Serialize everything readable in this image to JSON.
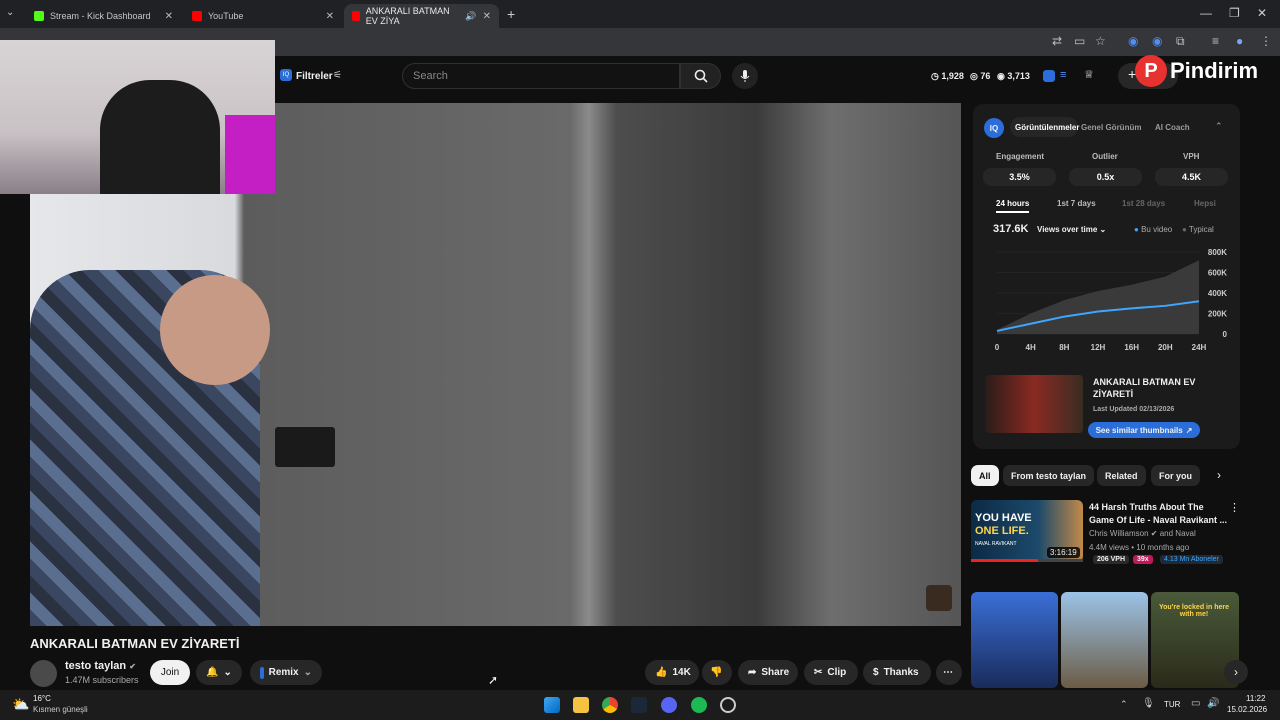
{
  "tabs": [
    {
      "label": "Stream - Kick Dashboard",
      "favicon_color": "#53fc18"
    },
    {
      "label": "YouTube",
      "favicon_color": "#ff0000"
    },
    {
      "label": "ANKARALI BATMAN EV ZİYA",
      "favicon_color": "#ff0000",
      "active": true
    }
  ],
  "yt": {
    "filters_label": "Filtreler",
    "search_placeholder": "Search",
    "stats": {
      "likes": "1,928",
      "comments": "76",
      "views": "3,713"
    },
    "create_label": "+ e"
  },
  "overlay": {
    "brand": "Pindirim"
  },
  "video": {
    "title": "ANKARALI BATMAN EV ZİYARETİ",
    "channel": "testo taylan",
    "subscribers": "1.47M subscribers",
    "join_label": "Join",
    "remix_label": "Remix",
    "like_count": "14K",
    "share_label": "Share",
    "clip_label": "Clip",
    "thanks_label": "Thanks"
  },
  "panel": {
    "tabs": [
      "Görüntülenmeler",
      "Genel Görünüm",
      "AI Coach"
    ],
    "metrics": [
      {
        "label": "Engagement",
        "value": "3.5%"
      },
      {
        "label": "Outlier",
        "value": "0.5x"
      },
      {
        "label": "VPH",
        "value": "4.5K"
      }
    ],
    "time_tabs": [
      "24 hours",
      "1st 7 days",
      "1st 28 days",
      "Hepsi"
    ],
    "views_total": "317.6K",
    "views_mode": "Views over time",
    "legend_this": "Bu video",
    "legend_typical": "Typical",
    "thumb_title": "ANKARALI BATMAN EV ZİYARETİ",
    "thumb_updated": "Last Updated 02/13/2026",
    "similar_label": "See similar thumbnails"
  },
  "chart_data": {
    "type": "area",
    "x": [
      "0",
      "4H",
      "8H",
      "12H",
      "16H",
      "20H",
      "24H"
    ],
    "y_ticks": [
      "0",
      "200K",
      "400K",
      "600K",
      "800K"
    ],
    "ylim": [
      0,
      800000
    ],
    "series": [
      {
        "name": "Bu video",
        "values": [
          30000,
          100000,
          170000,
          220000,
          250000,
          275000,
          320000
        ],
        "color": "#3ea6ff"
      },
      {
        "name": "Typical",
        "values": [
          40000,
          200000,
          330000,
          420000,
          480000,
          560000,
          720000
        ],
        "color": "#3a3a3a"
      }
    ]
  },
  "chips": [
    "All",
    "From testo taylan",
    "Related",
    "For you"
  ],
  "recommended": {
    "title_line1": "44 Harsh Truths About The",
    "title_line2": "Game Of Life - Naval Ravikant ...",
    "channel": "Chris Williamson",
    "channel_extra": "and Naval",
    "meta": "4.4M views • 10 months ago",
    "vph": "206 VPH",
    "multiplier": "39x",
    "subs": "4.13 Mn Aboneler",
    "duration": "3:16:19",
    "thumb_text1": "YOU HAVE",
    "thumb_text2": "ONE LIFE.",
    "thumb_sub": "NAVAL RAVIKANT"
  },
  "shorts_text": "You're locked in here with me!",
  "taskbar": {
    "temp": "16°C",
    "weather": "Kısmen güneşli",
    "lang": "TUR",
    "time": "11:22",
    "date": "15.02.2026"
  }
}
